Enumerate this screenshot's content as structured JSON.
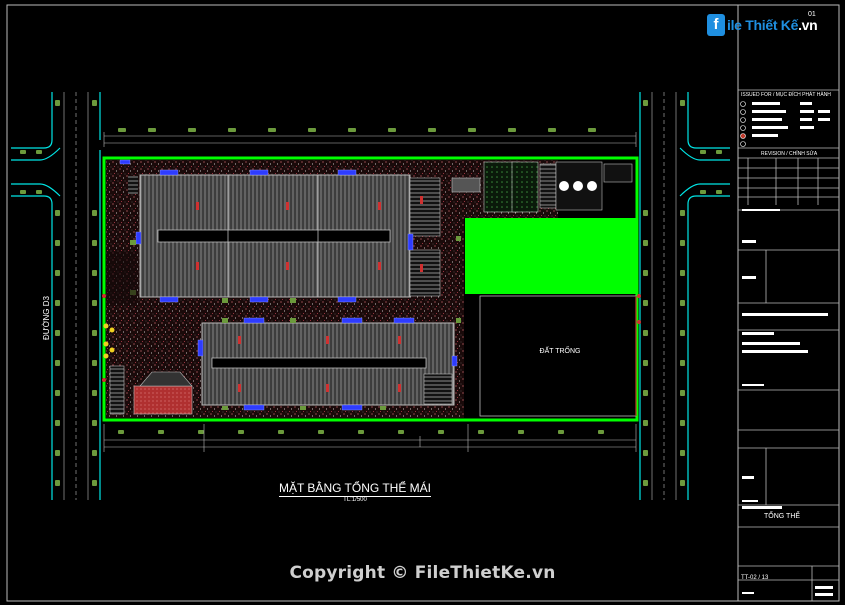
{
  "logo": {
    "tag": "f",
    "name": "ile Thiết Kế",
    "suffix": ".vn"
  },
  "sheet_code": "01",
  "drawing": {
    "title": "MẶT BẰNG TỔNG THỂ MÁI",
    "scale": "TL:1/500",
    "road_label": "ĐƯỜNG D3",
    "empty_lot_label": "ĐẤT TRỐNG"
  },
  "title_block": {
    "issued_for": "ISSUED FOR / MỤC ĐÍCH PHÁT HÀNH",
    "revision": "REVISION / CHỈNH SỬA",
    "sheet_name": "TỔNG THỂ",
    "sheet_number": "TT-02 / 13"
  },
  "copyright": "Copyright © FileThietKe.vn",
  "colors": {
    "background": "#000000",
    "site_boundary": "#00ff00",
    "green_area": "#00ff00",
    "road_cyan": "#00e5e5",
    "roof_gray": "#8a8a8a",
    "unit_blue": "#2e3cff",
    "landscape_red": "#c0392b",
    "tree_green": "#6b9a3c"
  }
}
